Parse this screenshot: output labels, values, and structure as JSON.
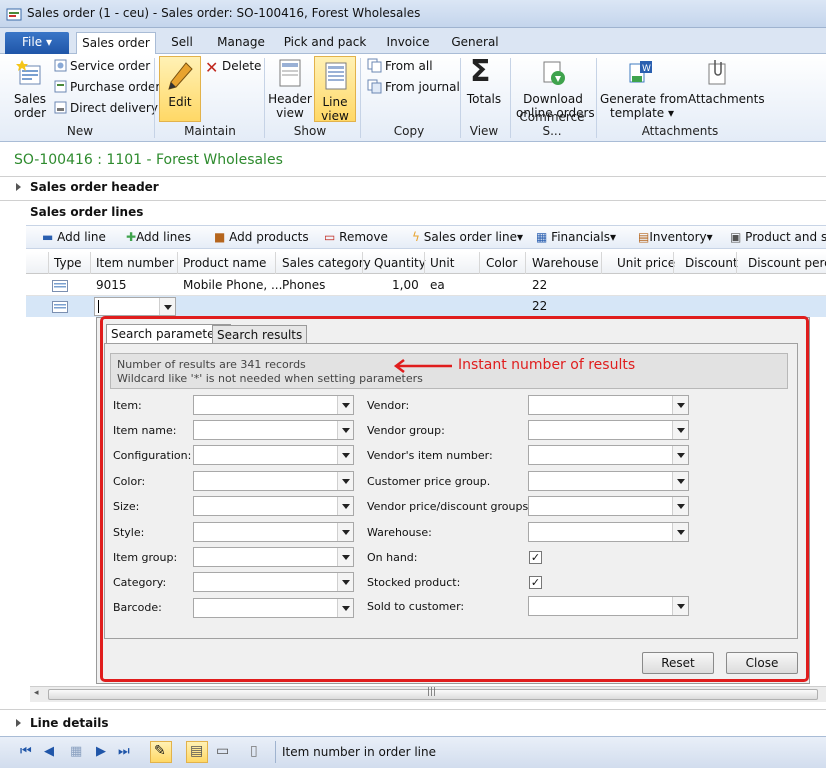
{
  "window": {
    "title": "Sales order (1 - ceu) - Sales order: SO-100416, Forest Wholesales"
  },
  "tabs": [
    {
      "label": "File"
    },
    {
      "label": "Sales order"
    },
    {
      "label": "Sell"
    },
    {
      "label": "Manage"
    },
    {
      "label": "Pick and pack"
    },
    {
      "label": "Invoice"
    },
    {
      "label": "General"
    }
  ],
  "ribbon": {
    "new": {
      "group": "New",
      "sales_order": [
        "Sales",
        "order"
      ],
      "service_order": "Service order",
      "purchase_order": "Purchase order",
      "direct_delivery": "Direct delivery"
    },
    "maintain": {
      "group": "Maintain",
      "edit": "Edit",
      "delete": "Delete"
    },
    "show": {
      "group": "Show",
      "header_view": [
        "Header",
        "view"
      ],
      "line_view": [
        "Line",
        "view"
      ]
    },
    "copy": {
      "group": "Copy",
      "from_all": "From all",
      "from_journal": "From journal"
    },
    "view": {
      "group": "View",
      "totals": "Totals"
    },
    "commerce": {
      "group": "Commerce S...",
      "download": [
        "Download",
        "online orders"
      ]
    },
    "attachments": {
      "group": "Attachments",
      "generate": [
        "Generate from",
        "template"
      ],
      "attachments": "Attachments"
    }
  },
  "record_title": "SO-100416 : 1101 - Forest Wholesales",
  "sections": {
    "header": "Sales order header",
    "lines": "Sales order lines",
    "line_details": "Line details"
  },
  "lines_toolbar": {
    "add_line": "Add line",
    "add_lines": "Add lines",
    "add_products": "Add products",
    "remove": "Remove",
    "sales_order_line": "Sales order line",
    "financials": "Financials",
    "inventory": "Inventory",
    "product": "Product and su"
  },
  "grid": {
    "columns": [
      "Type",
      "Item number",
      "Product name",
      "Sales category",
      "Quantity",
      "Unit",
      "Color",
      "Warehouse",
      "Unit price",
      "Discount",
      "Discount perce"
    ],
    "rows": [
      {
        "item": "9015",
        "product": "Mobile Phone, ...",
        "category": "Phones",
        "qty": "1,00",
        "unit": "ea",
        "warehouse": "22"
      },
      {
        "item": "",
        "product": "",
        "category": "",
        "qty": "",
        "unit": "",
        "warehouse": "22"
      }
    ]
  },
  "dialog": {
    "tabs": [
      "Search parameters",
      "Search results"
    ],
    "info_line1": "Number of results are 341 records",
    "info_line2": "Wildcard like '*' is not needed when setting parameters",
    "annotation": "Instant number of results",
    "left_fields": [
      "Item:",
      "Item name:",
      "Configuration:",
      "Color:",
      "Size:",
      "Style:",
      "Item group:",
      "Category:",
      "Barcode:"
    ],
    "right_fields": [
      "Vendor:",
      "Vendor group:",
      "Vendor's item number:",
      "Customer price group.",
      "Vendor price/discount groups:",
      "Warehouse:",
      "On hand:",
      "Stocked product:",
      "Sold to customer:"
    ],
    "reset": "Reset",
    "close": "Close"
  },
  "status": {
    "text": "Item number in order line"
  },
  "colors": {
    "accent": "#1f55a8",
    "title_green": "#2e8b2e",
    "annotation_red": "#e01d1d"
  }
}
